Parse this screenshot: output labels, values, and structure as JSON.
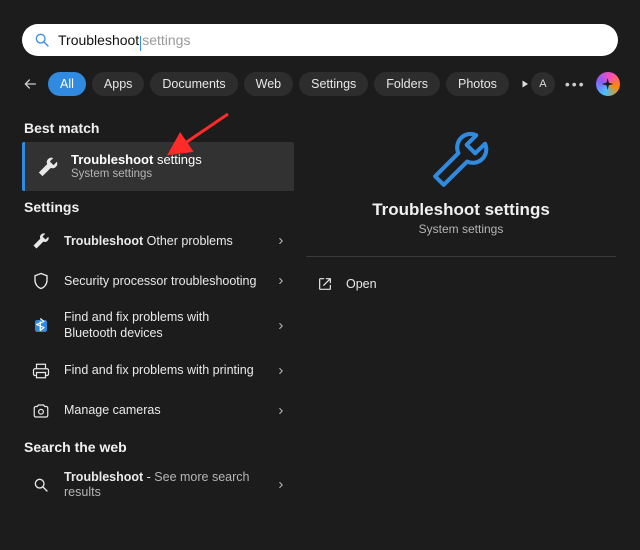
{
  "search": {
    "typed": "Troubleshoot",
    "ghost": " settings"
  },
  "filters": [
    "All",
    "Apps",
    "Documents",
    "Web",
    "Settings",
    "Folders",
    "Photos"
  ],
  "active_filter_index": 0,
  "avatar_letter": "A",
  "sections": {
    "best_match": "Best match",
    "settings": "Settings",
    "web": "Search the web"
  },
  "best_match": {
    "title_bold": "Troubleshoot",
    "title_rest": " settings",
    "subtitle": "System settings"
  },
  "settings_items": [
    {
      "icon": "wrench",
      "label_bold": "Troubleshoot",
      "label_rest": " Other problems"
    },
    {
      "icon": "shield",
      "label_plain": "Security processor troubleshooting"
    },
    {
      "icon": "bluetooth",
      "label_plain": "Find and fix problems with Bluetooth devices"
    },
    {
      "icon": "printer",
      "label_plain": "Find and fix problems with printing"
    },
    {
      "icon": "camera",
      "label_plain": "Manage cameras"
    }
  ],
  "web_items": [
    {
      "icon": "search",
      "label_bold": "Troubleshoot",
      "label_rest": " - ",
      "label_muted": "See more search results"
    }
  ],
  "detail": {
    "title": "Troubleshoot settings",
    "subtitle": "System settings",
    "actions": [
      {
        "icon": "open",
        "label": "Open"
      }
    ]
  },
  "accent_color": "#2f8ae0"
}
